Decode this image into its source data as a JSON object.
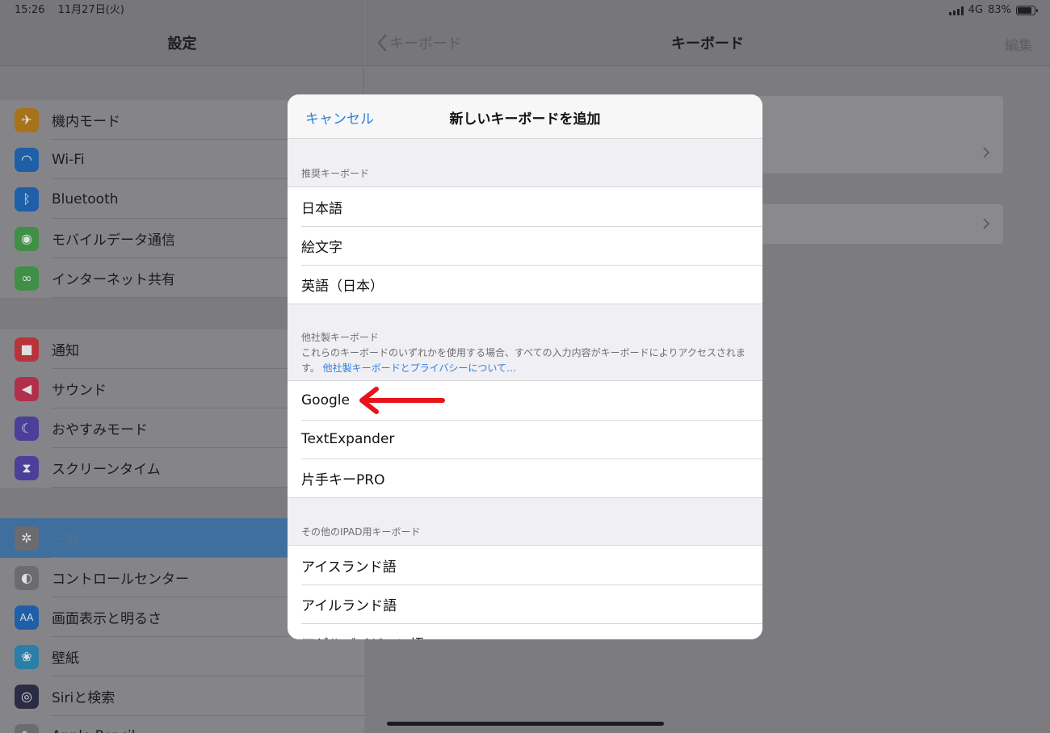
{
  "status_bar": {
    "time": "15:26",
    "date": "11月27日(火)",
    "network": "4G",
    "battery": "83%",
    "battery_level": 0.83
  },
  "sidebar": {
    "title": "設定",
    "groups": [
      [
        {
          "label": "機内モード",
          "icon": "airplane-icon",
          "color": "#a7731a"
        },
        {
          "label": "Wi-Fi",
          "icon": "wifi-icon",
          "color": "#1e5fa8"
        },
        {
          "label": "Bluetooth",
          "icon": "bluetooth-icon",
          "color": "#1e5fa8"
        },
        {
          "label": "モバイルデータ通信",
          "icon": "antenna-icon",
          "color": "#3f8f46"
        },
        {
          "label": "インターネット共有",
          "icon": "link-icon",
          "color": "#3f8f46"
        }
      ],
      [
        {
          "label": "通知",
          "icon": "notification-icon",
          "color": "#b8343a"
        },
        {
          "label": "サウンド",
          "icon": "sound-icon",
          "color": "#b0304b"
        },
        {
          "label": "おやすみモード",
          "icon": "moon-icon",
          "color": "#4b3f9a"
        },
        {
          "label": "スクリーンタイム",
          "icon": "hourglass-icon",
          "color": "#4b3f9a"
        }
      ],
      [
        {
          "label": "一般",
          "icon": "gear-icon",
          "color": "#6b6b70",
          "selected": true
        },
        {
          "label": "コントロールセンター",
          "icon": "toggles-icon",
          "color": "#6b6b70"
        },
        {
          "label": "画面表示と明るさ",
          "icon": "text-size-icon",
          "color": "#1e5fa8"
        },
        {
          "label": "壁紙",
          "icon": "flower-icon",
          "color": "#2a7fa8"
        },
        {
          "label": "Siriと検索",
          "icon": "siri-icon",
          "color": "#2b2b45"
        },
        {
          "label": "Apple Pencil",
          "icon": "pencil-icon",
          "color": "#6b6b70"
        }
      ]
    ]
  },
  "detail": {
    "back_label": "キーボード",
    "title": "キーボード",
    "edit_label": "編集"
  },
  "modal": {
    "cancel_label": "キャンセル",
    "title": "新しいキーボードを追加",
    "recommended": {
      "header": "推奨キーボード",
      "items": [
        "日本語",
        "絵文字",
        "英語（日本）"
      ]
    },
    "third_party": {
      "header": "他社製キーボード",
      "description": "これらのキーボードのいずれかを使用する場合、すべての入力内容がキーボードによりアクセスされます。",
      "link": "他社製キーボードとプライバシーについて…",
      "items": [
        "Google",
        "TextExpander",
        "片手キーPRO"
      ]
    },
    "other": {
      "header": "その他のIPAD用キーボード",
      "items": [
        "アイスランド語",
        "アイルランド語",
        "アゼルバイジャン語"
      ]
    }
  },
  "annotation": {
    "arrow_color": "#e8141b",
    "points_to": "Google"
  }
}
